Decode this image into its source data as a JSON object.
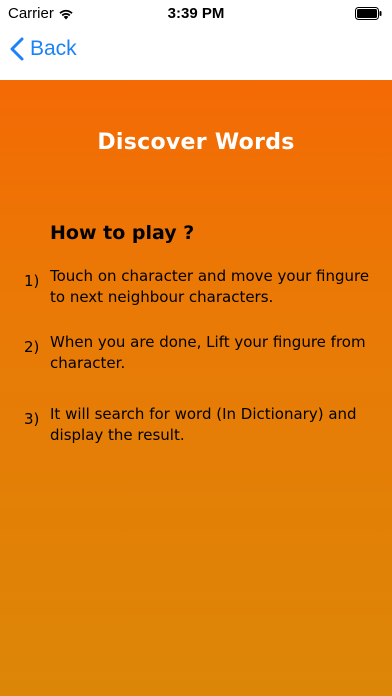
{
  "status_bar": {
    "carrier": "Carrier",
    "time": "3:39 PM",
    "wifi_icon": "wifi-icon",
    "battery_icon": "battery-icon"
  },
  "nav": {
    "back_label": "Back",
    "back_icon": "chevron-left-icon"
  },
  "main": {
    "title": "Discover Words",
    "heading": "How to play ?",
    "steps": [
      {
        "number": "1)",
        "text": "Touch on character and move your fingure to next neighbour characters."
      },
      {
        "number": "2)",
        "text": "When you are done, Lift your fingure from character."
      },
      {
        "number": "3)",
        "text": "It will search for word (In Dictionary) and display the result."
      }
    ]
  },
  "colors": {
    "accent": "#1b82f8",
    "gradient_top": "#f46a05",
    "gradient_bottom": "#dc8607",
    "title_color": "#ffffff"
  }
}
